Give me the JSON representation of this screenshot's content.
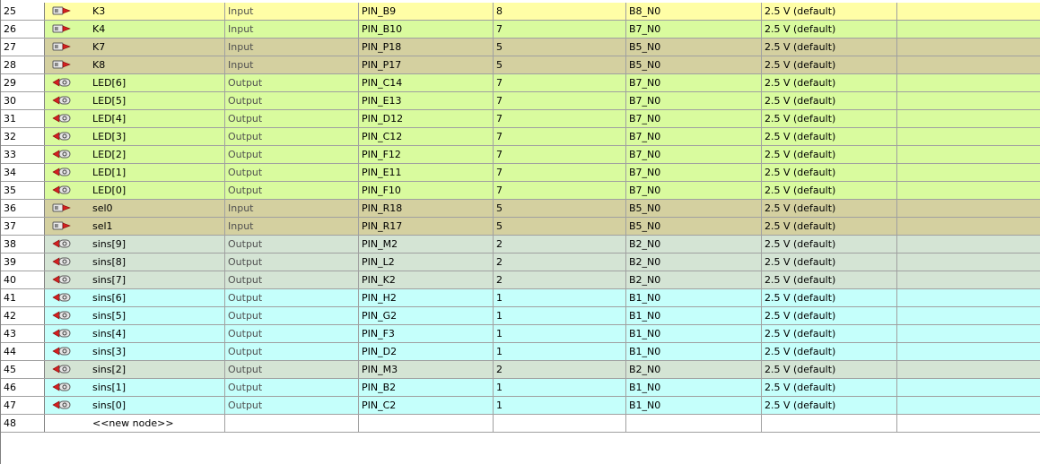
{
  "colors": {
    "input_green": "#d9fb9e",
    "selected_yellow": "#fffea6",
    "olive": "#d4d0a0",
    "grey_green": "#d4e4d4",
    "cyan": "#c5fffb"
  },
  "rows": [
    {
      "num": "25",
      "icon": "input-pin-icon",
      "name": "K3",
      "dir": "Input",
      "loc": "PIN_B9",
      "iobank": "8",
      "vref": "B8_N0",
      "iostd": "2.5 V (default)",
      "color": "yellow"
    },
    {
      "num": "26",
      "icon": "input-pin-icon",
      "name": "K4",
      "dir": "Input",
      "loc": "PIN_B10",
      "iobank": "7",
      "vref": "B7_N0",
      "iostd": "2.5 V (default)",
      "color": "green"
    },
    {
      "num": "27",
      "icon": "input-pin-icon",
      "name": "K7",
      "dir": "Input",
      "loc": "PIN_P18",
      "iobank": "5",
      "vref": "B5_N0",
      "iostd": "2.5 V (default)",
      "color": "olive"
    },
    {
      "num": "28",
      "icon": "input-pin-icon",
      "name": "K8",
      "dir": "Input",
      "loc": "PIN_P17",
      "iobank": "5",
      "vref": "B5_N0",
      "iostd": "2.5 V (default)",
      "color": "olive"
    },
    {
      "num": "29",
      "icon": "output-pin-icon",
      "name": "LED[6]",
      "dir": "Output",
      "loc": "PIN_C14",
      "iobank": "7",
      "vref": "B7_N0",
      "iostd": "2.5 V (default)",
      "color": "green"
    },
    {
      "num": "30",
      "icon": "output-pin-icon",
      "name": "LED[5]",
      "dir": "Output",
      "loc": "PIN_E13",
      "iobank": "7",
      "vref": "B7_N0",
      "iostd": "2.5 V (default)",
      "color": "green"
    },
    {
      "num": "31",
      "icon": "output-pin-icon",
      "name": "LED[4]",
      "dir": "Output",
      "loc": "PIN_D12",
      "iobank": "7",
      "vref": "B7_N0",
      "iostd": "2.5 V (default)",
      "color": "green"
    },
    {
      "num": "32",
      "icon": "output-pin-icon",
      "name": "LED[3]",
      "dir": "Output",
      "loc": "PIN_C12",
      "iobank": "7",
      "vref": "B7_N0",
      "iostd": "2.5 V (default)",
      "color": "green"
    },
    {
      "num": "33",
      "icon": "output-pin-icon",
      "name": "LED[2]",
      "dir": "Output",
      "loc": "PIN_F12",
      "iobank": "7",
      "vref": "B7_N0",
      "iostd": "2.5 V (default)",
      "color": "green"
    },
    {
      "num": "34",
      "icon": "output-pin-icon",
      "name": "LED[1]",
      "dir": "Output",
      "loc": "PIN_E11",
      "iobank": "7",
      "vref": "B7_N0",
      "iostd": "2.5 V (default)",
      "color": "green"
    },
    {
      "num": "35",
      "icon": "output-pin-icon",
      "name": "LED[0]",
      "dir": "Output",
      "loc": "PIN_F10",
      "iobank": "7",
      "vref": "B7_N0",
      "iostd": "2.5 V (default)",
      "color": "green"
    },
    {
      "num": "36",
      "icon": "input-pin-icon",
      "name": "sel0",
      "dir": "Input",
      "loc": "PIN_R18",
      "iobank": "5",
      "vref": "B5_N0",
      "iostd": "2.5 V (default)",
      "color": "olive"
    },
    {
      "num": "37",
      "icon": "input-pin-icon",
      "name": "sel1",
      "dir": "Input",
      "loc": "PIN_R17",
      "iobank": "5",
      "vref": "B5_N0",
      "iostd": "2.5 V (default)",
      "color": "olive"
    },
    {
      "num": "38",
      "icon": "output-pin-icon",
      "name": "sins[9]",
      "dir": "Output",
      "loc": "PIN_M2",
      "iobank": "2",
      "vref": "B2_N0",
      "iostd": "2.5 V (default)",
      "color": "grey"
    },
    {
      "num": "39",
      "icon": "output-pin-icon",
      "name": "sins[8]",
      "dir": "Output",
      "loc": "PIN_L2",
      "iobank": "2",
      "vref": "B2_N0",
      "iostd": "2.5 V (default)",
      "color": "grey"
    },
    {
      "num": "40",
      "icon": "output-pin-icon",
      "name": "sins[7]",
      "dir": "Output",
      "loc": "PIN_K2",
      "iobank": "2",
      "vref": "B2_N0",
      "iostd": "2.5 V (default)",
      "color": "grey"
    },
    {
      "num": "41",
      "icon": "output-pin-icon",
      "name": "sins[6]",
      "dir": "Output",
      "loc": "PIN_H2",
      "iobank": "1",
      "vref": "B1_N0",
      "iostd": "2.5 V (default)",
      "color": "cyan"
    },
    {
      "num": "42",
      "icon": "output-pin-icon",
      "name": "sins[5]",
      "dir": "Output",
      "loc": "PIN_G2",
      "iobank": "1",
      "vref": "B1_N0",
      "iostd": "2.5 V (default)",
      "color": "cyan"
    },
    {
      "num": "43",
      "icon": "output-pin-icon",
      "name": "sins[4]",
      "dir": "Output",
      "loc": "PIN_F3",
      "iobank": "1",
      "vref": "B1_N0",
      "iostd": "2.5 V (default)",
      "color": "cyan"
    },
    {
      "num": "44",
      "icon": "output-pin-icon",
      "name": "sins[3]",
      "dir": "Output",
      "loc": "PIN_D2",
      "iobank": "1",
      "vref": "B1_N0",
      "iostd": "2.5 V (default)",
      "color": "cyan"
    },
    {
      "num": "45",
      "icon": "output-pin-icon",
      "name": "sins[2]",
      "dir": "Output",
      "loc": "PIN_M3",
      "iobank": "2",
      "vref": "B2_N0",
      "iostd": "2.5 V (default)",
      "color": "grey"
    },
    {
      "num": "46",
      "icon": "output-pin-icon",
      "name": "sins[1]",
      "dir": "Output",
      "loc": "PIN_B2",
      "iobank": "1",
      "vref": "B1_N0",
      "iostd": "2.5 V (default)",
      "color": "cyan"
    },
    {
      "num": "47",
      "icon": "output-pin-icon",
      "name": "sins[0]",
      "dir": "Output",
      "loc": "PIN_C2",
      "iobank": "1",
      "vref": "B1_N0",
      "iostd": "2.5 V (default)",
      "color": "cyan"
    },
    {
      "num": "48",
      "icon": "",
      "name": "<<new node>>",
      "dir": "",
      "loc": "",
      "iobank": "",
      "vref": "",
      "iostd": "",
      "color": "blank"
    }
  ]
}
